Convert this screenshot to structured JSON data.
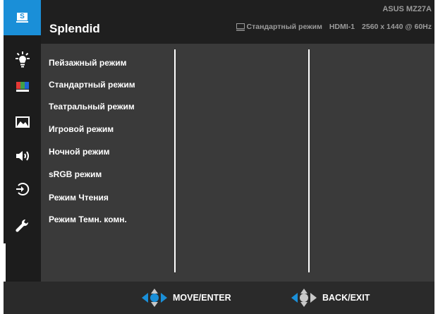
{
  "header": {
    "title": "Splendid",
    "model": "ASUS MZ27A",
    "mode_text": "Стандартный режим",
    "input": "HDMI-1",
    "resolution": "2560 x 1440 @ 60Hz"
  },
  "sidebar": {
    "items": [
      {
        "icon": "splendid-icon",
        "label": "S",
        "active": true
      },
      {
        "icon": "brightness-icon",
        "active": false
      },
      {
        "icon": "color-icon",
        "active": false
      },
      {
        "icon": "image-icon",
        "active": false
      },
      {
        "icon": "sound-icon",
        "active": false
      },
      {
        "icon": "input-select-icon",
        "active": false
      },
      {
        "icon": "system-setup-icon",
        "active": false
      }
    ]
  },
  "menu": {
    "items": [
      "Пейзажный режим",
      "Стандартный режим",
      "Театральный режим",
      "Игровой режим",
      "Ночной режим",
      "sRGB режим",
      "Режим Чтения",
      "Режим Темн. комн."
    ]
  },
  "footer": {
    "move_label": "MOVE/ENTER",
    "back_label": "BACK/EXIT"
  },
  "colors": {
    "accent": "#1a8fd8",
    "header_bg": "#1f1f1f",
    "content_bg": "#3a3a3a",
    "footer_bg": "#2a2a2a",
    "muted_text": "#9b9b9b"
  }
}
